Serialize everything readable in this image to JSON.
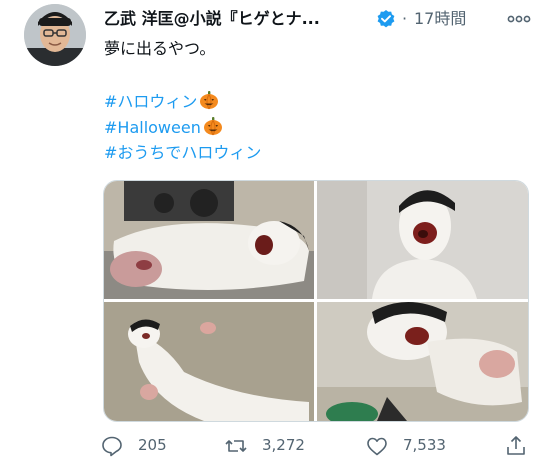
{
  "tweet": {
    "display_name": "乙武 洋匡@小説『ヒゲとナ...",
    "verified": true,
    "separator": "·",
    "timestamp": "17時間",
    "more_label": "ooo",
    "text": "夢に出るやつ。",
    "hashtags": [
      {
        "label": "#ハロウィン",
        "emoji": "pumpkin-emoji"
      },
      {
        "label": "#Halloween",
        "emoji": "pumpkin-emoji"
      },
      {
        "label": "#おうちでハロウィン",
        "emoji": ""
      }
    ],
    "media": [
      {
        "alt": "photo-1"
      },
      {
        "alt": "photo-2"
      },
      {
        "alt": "photo-3"
      },
      {
        "alt": "photo-4"
      }
    ]
  },
  "actions": {
    "reply_count": "205",
    "retweet_count": "3,272",
    "like_count": "7,533",
    "icons": {
      "reply": "reply-icon",
      "retweet": "retweet-icon",
      "like": "like-icon",
      "share": "share-icon"
    }
  },
  "colors": {
    "link": "#1d9bf0",
    "text": "#0f1419",
    "muted": "#536471",
    "border": "#cfd9de",
    "verified": "#1d9bf0"
  }
}
